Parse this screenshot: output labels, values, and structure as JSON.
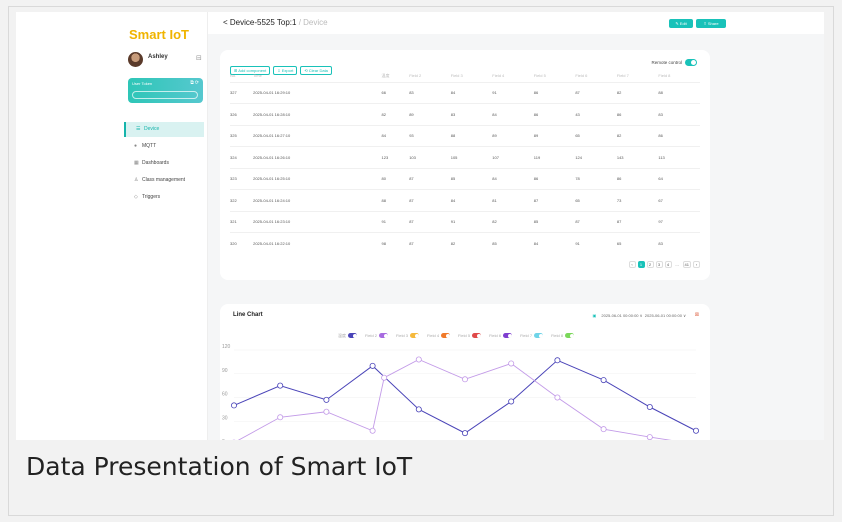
{
  "app": {
    "logo": "Smart IoT"
  },
  "user": {
    "name": "Ashley",
    "token_title": "User Token"
  },
  "nav": [
    {
      "label": "Device",
      "icon": "list-icon",
      "active": true
    },
    {
      "label": "MQTT",
      "icon": "chat-icon"
    },
    {
      "label": "Dashboards",
      "icon": "grid-icon"
    },
    {
      "label": "Class management",
      "icon": "user-icon"
    },
    {
      "label": "Triggers",
      "icon": "shield-icon"
    }
  ],
  "header": {
    "title": "Device-5525 Top:1",
    "sub": "/ Device",
    "edit_label": "Edit",
    "share_label": "Share"
  },
  "toolbar": {
    "add": "Add component",
    "export": "Export",
    "clear": "Clear Data",
    "remote": "Remote control"
  },
  "table": {
    "columns": [
      "No.",
      "Time",
      "温度",
      "Field 2",
      "Field 3",
      "Field 4",
      "Field 5",
      "Field 6",
      "Field 7",
      "Field 8"
    ],
    "rows": [
      [
        "327",
        "2025-04-01 16:29:10",
        "66",
        "83",
        "84",
        "91",
        "86",
        "87",
        "82",
        "88"
      ],
      [
        "326",
        "2025-04-01 16:28:10",
        "82",
        "89",
        "83",
        "84",
        "86",
        "43",
        "86",
        "83"
      ],
      [
        "325",
        "2025-04-01 16:27:10",
        "84",
        "93",
        "88",
        "89",
        "89",
        "65",
        "82",
        "86"
      ],
      [
        "324",
        "2025-04-01 16:26:10",
        "123",
        "103",
        "105",
        "107",
        "119",
        "124",
        "143",
        "113"
      ],
      [
        "323",
        "2025-04-01 16:25:10",
        "80",
        "87",
        "85",
        "84",
        "86",
        "78",
        "86",
        "64"
      ],
      [
        "322",
        "2025-04-01 16:24:10",
        "88",
        "87",
        "84",
        "81",
        "87",
        "65",
        "73",
        "67"
      ],
      [
        "321",
        "2025-04-01 16:23:10",
        "91",
        "87",
        "91",
        "82",
        "85",
        "87",
        "87",
        "97"
      ],
      [
        "320",
        "2025-04-01 16:22:10",
        "98",
        "87",
        "82",
        "85",
        "84",
        "91",
        "65",
        "83"
      ]
    ]
  },
  "pagination": {
    "pages": [
      "1",
      "2",
      "3",
      "4",
      "...",
      "41"
    ]
  },
  "chart_header": {
    "title": "Line Chart",
    "start": "2025-06-01 00:00:00",
    "end": "2025-06-01 00:00:00"
  },
  "chart_legend": [
    {
      "label": "温度",
      "color": "#4a44b8"
    },
    {
      "label": "Field 2",
      "color": "#a76be0"
    },
    {
      "label": "Field 3",
      "color": "#f5b93c"
    },
    {
      "label": "Field 4",
      "color": "#f07a2a"
    },
    {
      "label": "Field 5",
      "color": "#e04a4a"
    },
    {
      "label": "Field 6",
      "color": "#7f3fd0"
    },
    {
      "label": "Field 7",
      "color": "#6fd4e8"
    },
    {
      "label": "Field 8",
      "color": "#7bd85a"
    }
  ],
  "chart_data": {
    "type": "line",
    "ylim": [
      0,
      120
    ],
    "yticks": [
      "120",
      "90",
      "60",
      "30",
      "0"
    ],
    "series": [
      {
        "name": "温度",
        "color": "#4a44b8",
        "values": [
          50,
          75,
          57,
          100,
          45,
          15,
          55,
          107,
          82,
          48,
          18
        ]
      },
      {
        "name": "Field 2",
        "color": "#c39be8",
        "values": [
          3,
          35,
          42,
          18,
          85,
          108,
          83,
          103,
          60,
          20,
          10,
          1
        ]
      }
    ],
    "series_x": [
      [
        0,
        1,
        2,
        3,
        4,
        5,
        6,
        7,
        8,
        9,
        10
      ],
      [
        0,
        1,
        2,
        3,
        3.25,
        4,
        5,
        6,
        7,
        8,
        9,
        10
      ]
    ]
  }
}
